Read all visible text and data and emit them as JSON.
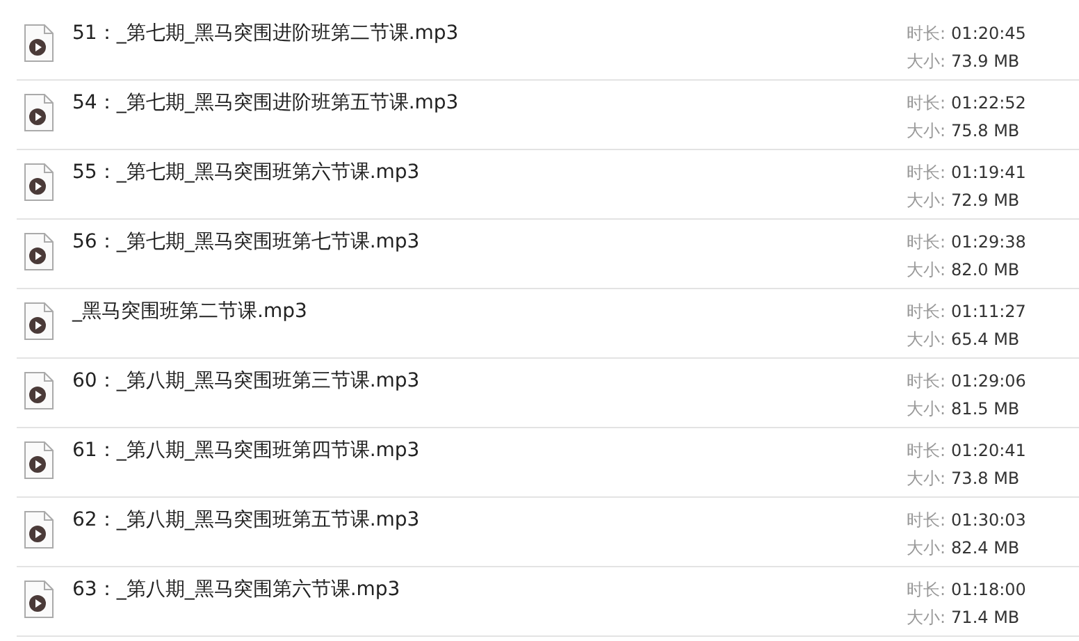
{
  "files": [
    {
      "name": "51：_第七期_黑马突围进阶班第二节课.mp3",
      "duration_label": "时长:",
      "duration": "01:20:45",
      "size_label": "大小:",
      "size": "73.9 MB"
    },
    {
      "name": "54：_第七期_黑马突围进阶班第五节课.mp3",
      "duration_label": "时长:",
      "duration": "01:22:52",
      "size_label": "大小:",
      "size": "75.8 MB"
    },
    {
      "name": "55：_第七期_黑马突围班第六节课.mp3",
      "duration_label": "时长:",
      "duration": "01:19:41",
      "size_label": "大小:",
      "size": "72.9 MB"
    },
    {
      "name": "56：_第七期_黑马突围班第七节课.mp3",
      "duration_label": "时长:",
      "duration": "01:29:38",
      "size_label": "大小:",
      "size": "82.0 MB"
    },
    {
      "name": "_黑马突围班第二节课.mp3",
      "duration_label": "时长:",
      "duration": "01:11:27",
      "size_label": "大小:",
      "size": "65.4 MB"
    },
    {
      "name": "60：_第八期_黑马突围班第三节课.mp3",
      "duration_label": "时长:",
      "duration": "01:29:06",
      "size_label": "大小:",
      "size": "81.5 MB"
    },
    {
      "name": "61：_第八期_黑马突围班第四节课.mp3",
      "duration_label": "时长:",
      "duration": "01:20:41",
      "size_label": "大小:",
      "size": "73.8 MB"
    },
    {
      "name": "62：_第八期_黑马突围班第五节课.mp3",
      "duration_label": "时长:",
      "duration": "01:30:03",
      "size_label": "大小:",
      "size": "82.4 MB"
    },
    {
      "name": "63：_第八期_黑马突围第六节课.mp3",
      "duration_label": "时长:",
      "duration": "01:18:00",
      "size_label": "大小:",
      "size": "71.4 MB"
    }
  ]
}
